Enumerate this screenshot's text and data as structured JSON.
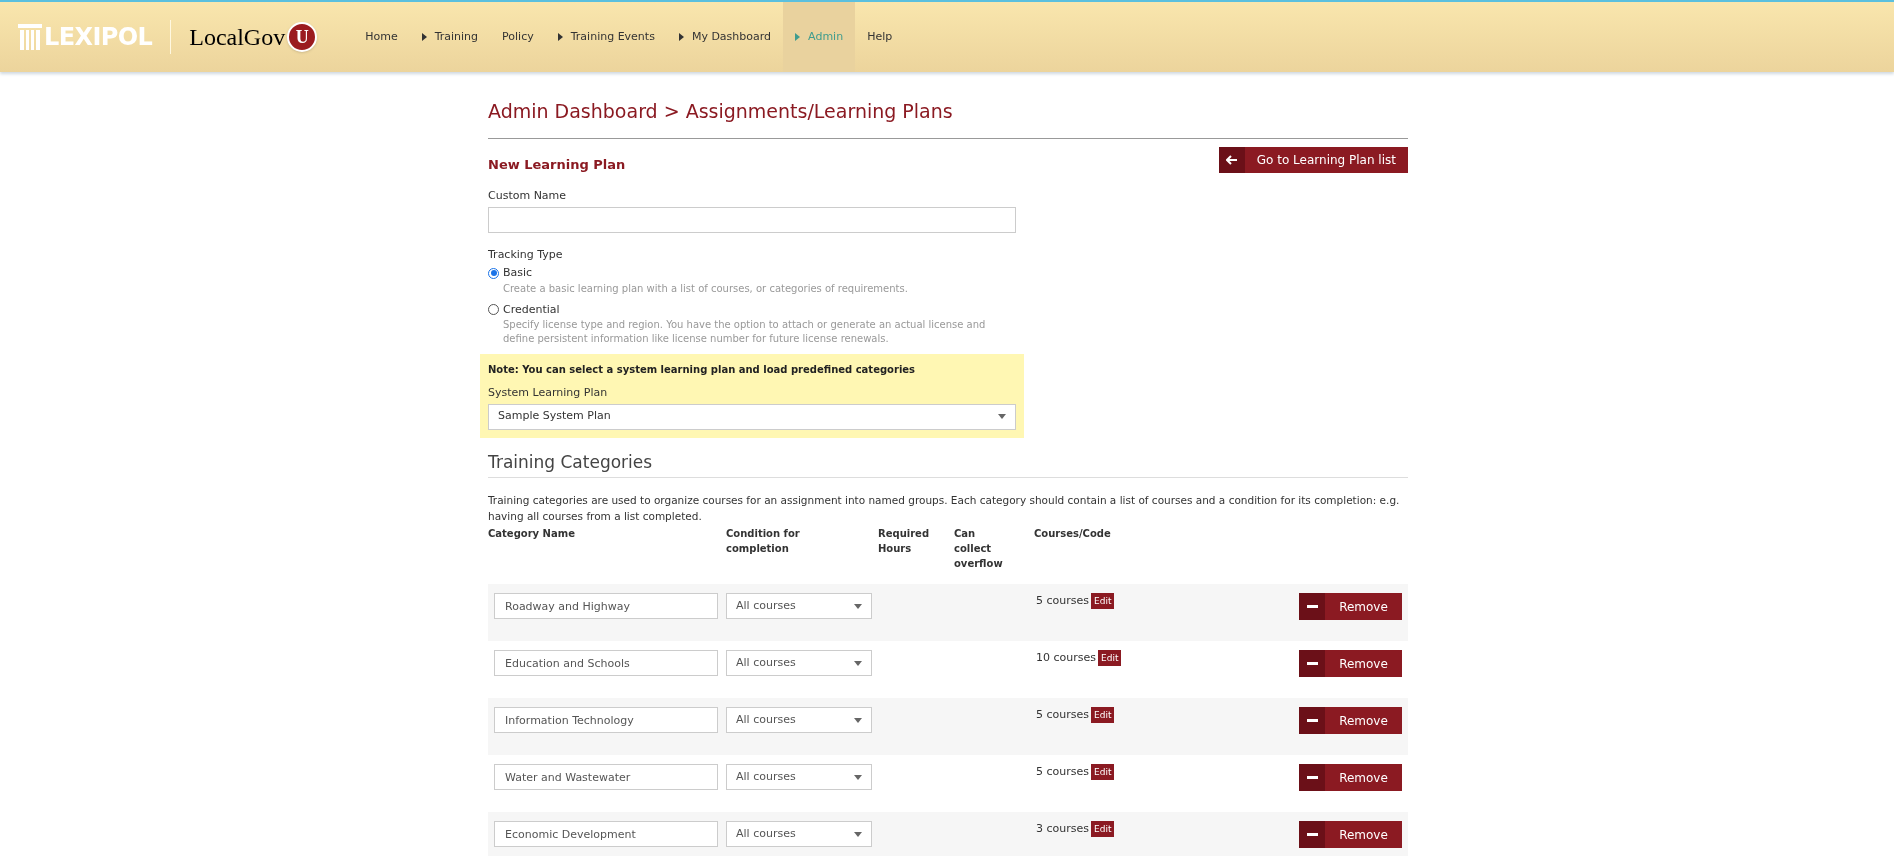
{
  "logo": {
    "brand": "LEXIPOL",
    "product": "LocalGov",
    "badge": "U"
  },
  "nav": [
    {
      "label": "Home",
      "submenu": false,
      "selected": false
    },
    {
      "label": "Training",
      "submenu": true,
      "selected": false
    },
    {
      "label": "Policy",
      "submenu": false,
      "selected": false
    },
    {
      "label": "Training Events",
      "submenu": true,
      "selected": false
    },
    {
      "label": "My Dashboard",
      "submenu": true,
      "selected": false
    },
    {
      "label": "Admin",
      "submenu": true,
      "selected": true
    },
    {
      "label": "Help",
      "submenu": false,
      "selected": false
    }
  ],
  "breadcrumb": "Admin Dashboard > Assignments/Learning Plans",
  "form_title": "New Learning Plan",
  "back_button": "Go to Learning Plan list",
  "custom_name": {
    "label": "Custom Name"
  },
  "tracking_type": {
    "label": "Tracking Type",
    "options": [
      {
        "label": "Basic",
        "description": "Create a basic learning plan with a list of courses, or categories of requirements.",
        "selected": true
      },
      {
        "label": "Credential",
        "description": "Specify license type and region. You have the option to attach or generate an actual license and define persistent information like license number for future license renewals.",
        "selected": false
      }
    ]
  },
  "note": {
    "text": "Note: You can select a system learning plan and load predefined categories",
    "label": "System Learning Plan",
    "value": "Sample System Plan"
  },
  "categories": {
    "title": "Training Categories",
    "description": "Training categories are used to organize courses for an assignment into named groups. Each category should contain a list of courses and a condition for its completion: e.g. having all courses from a list completed.",
    "columns": [
      "Category Name",
      "Condition for completion",
      "Required Hours",
      "Can collect overflow",
      "Courses/Code"
    ],
    "rows": [
      {
        "name": "Roadway and Highway",
        "condition": "All courses",
        "courses": "5 courses",
        "edit": "Edit",
        "remove": "Remove"
      },
      {
        "name": "Education and Schools",
        "condition": "All courses",
        "courses": "10 courses",
        "edit": "Edit",
        "remove": "Remove"
      },
      {
        "name": "Information Technology",
        "condition": "All courses",
        "courses": "5 courses",
        "edit": "Edit",
        "remove": "Remove"
      },
      {
        "name": "Water and Wastewater",
        "condition": "All courses",
        "courses": "5 courses",
        "edit": "Edit",
        "remove": "Remove"
      },
      {
        "name": "Economic Development",
        "condition": "All courses",
        "courses": "3 courses",
        "edit": "Edit",
        "remove": "Remove"
      }
    ]
  }
}
